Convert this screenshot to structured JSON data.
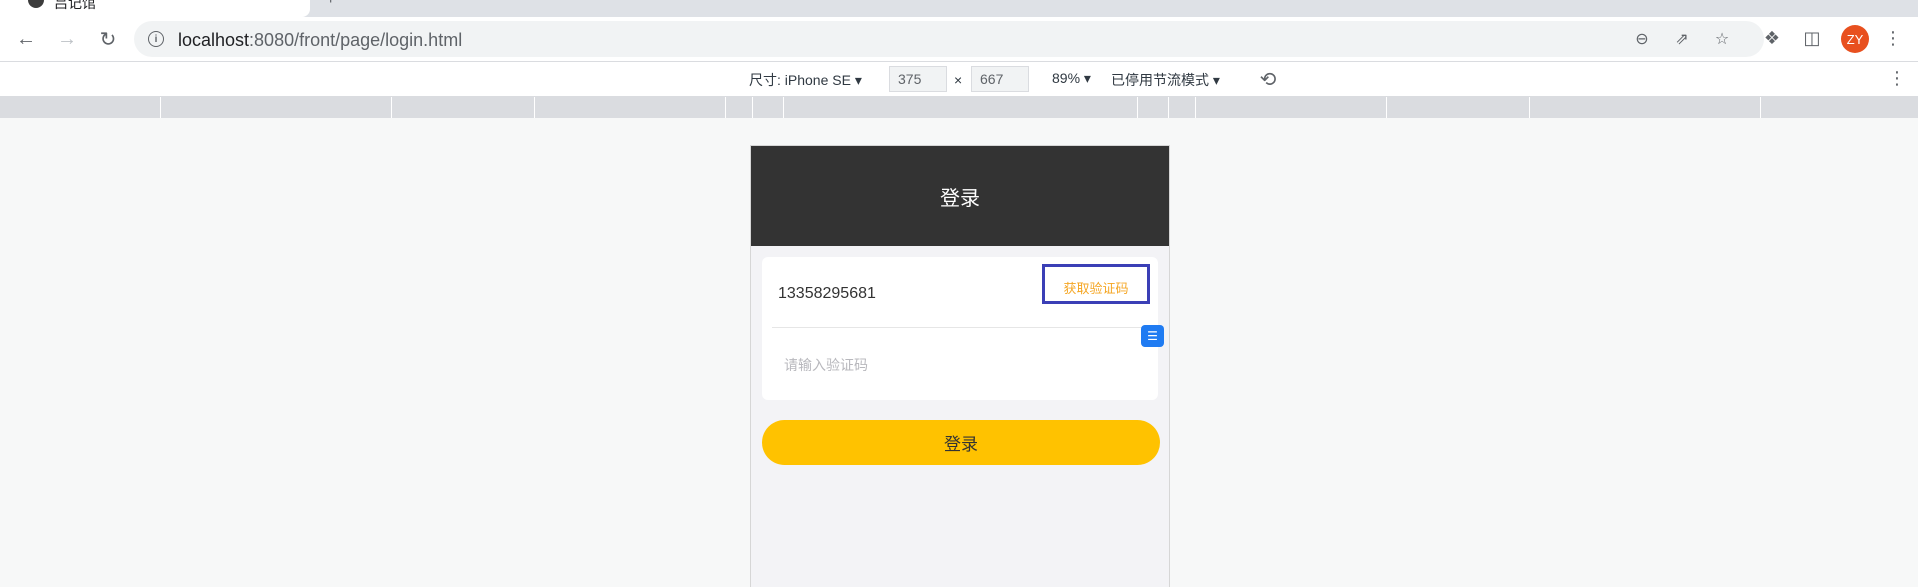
{
  "browser": {
    "tab": {
      "title": "吕记馆"
    },
    "url": {
      "host": "localhost",
      "path": ":8080/front/page/login.html"
    },
    "icons": {
      "back": "arrow-left-icon",
      "forward": "arrow-right-icon",
      "reload": "reload-icon",
      "zoom": "zoom-out-icon",
      "share": "share-icon",
      "bookmark": "star-icon",
      "extensions": "puzzle-icon",
      "sidepanel": "side-panel-icon",
      "menu": "kebab-menu-icon"
    },
    "avatar_initials": "ZY",
    "avatar_color": "#e8501f"
  },
  "devtools": {
    "device_label": "尺寸: iPhone SE",
    "width": "375",
    "height": "667",
    "zoom": "89%",
    "throttle": "已停用节流模式"
  },
  "app": {
    "header_title": "登录",
    "phone_value": "13358295681",
    "get_code_label": "获取验证码",
    "code_placeholder": "请输入验证码",
    "login_button": "登录",
    "accent_color": "#ffc200",
    "header_color": "#333333"
  }
}
